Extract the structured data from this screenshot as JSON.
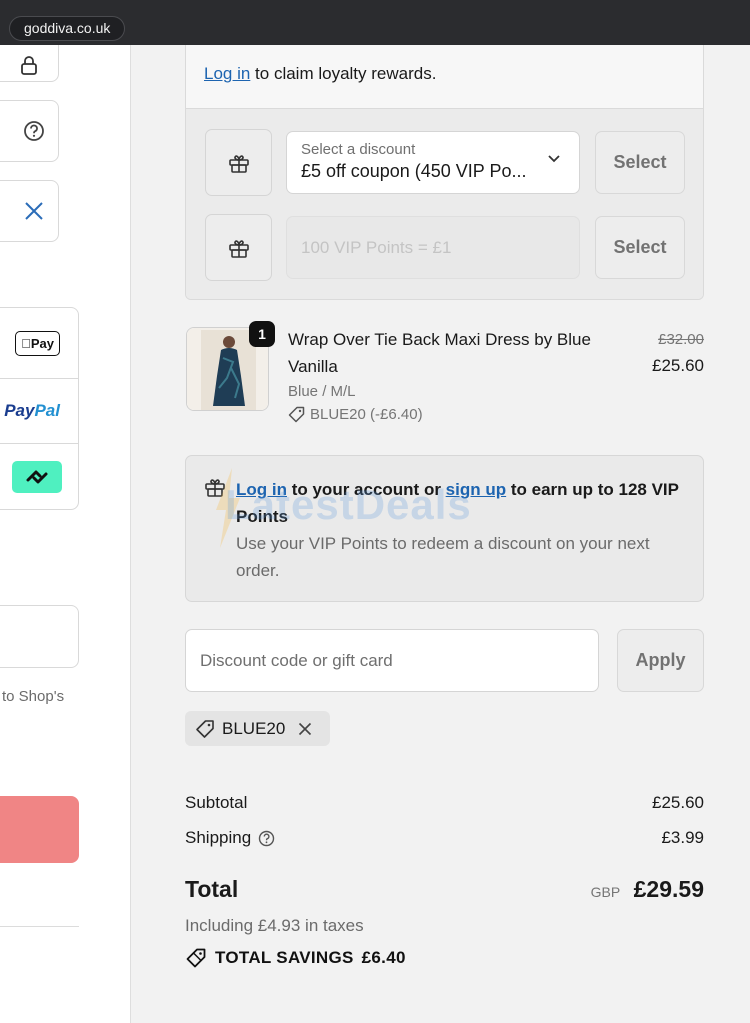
{
  "browser": {
    "url": "goddiva.co.uk"
  },
  "left_panel": {
    "wallets": [
      "Apple Pay",
      "PayPal",
      "Affirm"
    ],
    "apple_pay_label": "Pay",
    "paypal_label_a": "Pay",
    "paypal_label_b": "Pal",
    "shop_text": "to Shop's"
  },
  "loyalty": {
    "login_link": "Log in",
    "login_text": " to claim loyalty rewards.",
    "discount_select_label": "Select a discount",
    "discount_select_value": "£5 off coupon (450 VIP Po...",
    "select_button": "Select",
    "points_placeholder": "100 VIP Points = £1",
    "select_button_2": "Select"
  },
  "product": {
    "quantity": "1",
    "name": "Wrap Over Tie Back Maxi Dress by Blue Vanilla",
    "variant": "Blue / M/L",
    "coupon": "BLUE20 (-£6.40)",
    "original_price": "£32.00",
    "price": "£25.60"
  },
  "vip_box": {
    "login_link": "Log in",
    "text_1": " to your account or ",
    "signup_link": "sign up",
    "text_2": " to earn up to 128 VIP Points",
    "subtext": "Use your VIP Points to redeem a discount on your next order."
  },
  "watermark": "LatestDeals",
  "discount": {
    "placeholder": "Discount code or gift card",
    "apply_label": "Apply",
    "applied_code": "BLUE20"
  },
  "summary": {
    "subtotal_label": "Subtotal",
    "subtotal_value": "£25.60",
    "shipping_label": "Shipping",
    "shipping_value": "£3.99",
    "total_label": "Total",
    "currency": "GBP",
    "total_value": "£29.59",
    "taxes": "Including £4.93 in taxes",
    "savings_label": "TOTAL SAVINGS",
    "savings_value": "£6.40"
  }
}
